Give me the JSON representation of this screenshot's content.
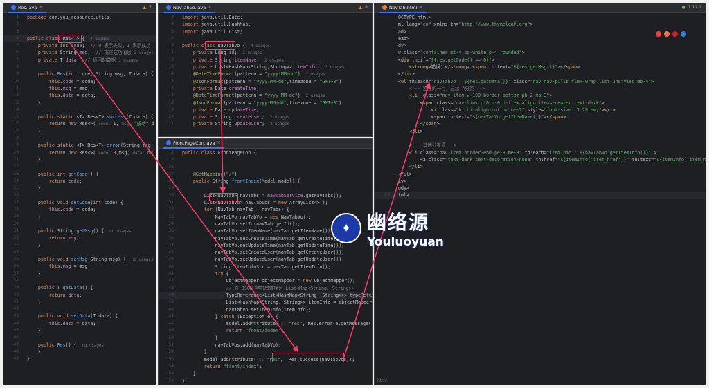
{
  "panes": {
    "res": {
      "tab": "Res.java",
      "status": "7",
      "lines": [
        {
          "n": "1",
          "html": "<span class='kw'>package</span> com.you_resource.utils;"
        },
        {
          "n": "2",
          "html": ""
        },
        {
          "n": "3",
          "html": ""
        },
        {
          "n": "4",
          "html": "<span class='kw'>public class</span> Res&lt;T&gt; {  <span class='hint'>7 usages</span>"
        },
        {
          "n": "5",
          "html": "    <span class='kw'>private int</span> <span class='fld'>code</span>;  <span class='cm'>// 0 表示失败，1 表示成功</span>"
        },
        {
          "n": "6",
          "html": "    <span class='kw'>private</span> String <span class='fld'>msg</span>;  <span class='cm'>// 描述成功消息</span> <span class='hint'>3 usages</span>"
        },
        {
          "n": "7",
          "html": "    <span class='kw'>private</span> T <span class='fld'>data</span>;  <span class='cm'>// 返回的数据</span> <span class='hint'>3 usages</span>"
        },
        {
          "n": "8",
          "html": ""
        },
        {
          "n": "9",
          "html": "    <span class='kw'>public</span> <span class='fn'>Res</span>(<span class='kw'>int</span> code, String msg, T data) {"
        },
        {
          "n": "10",
          "html": "        <span class='kw'>this</span>.<span class='fld'>code</span> = code;"
        },
        {
          "n": "11",
          "html": "        <span class='kw'>this</span>.<span class='fld'>msg</span> = msg;"
        },
        {
          "n": "12",
          "html": "        <span class='kw'>this</span>.<span class='fld'>data</span> = data;"
        },
        {
          "n": "13",
          "html": "    }"
        },
        {
          "n": "14",
          "html": ""
        },
        {
          "n": "15",
          "html": "    <span class='kw'>public static</span> &lt;T&gt; Res&lt;T&gt; <span class='fn'>success</span>(T data) {"
        },
        {
          "n": "16",
          "html": "        <span class='kw'>return new</span> Res&lt;&gt;( <span class='hint'>code:</span> 1, <span class='hint'>msg:</span> <span class='str'>\"成功\"</span>,d"
        },
        {
          "n": "17",
          "html": "    }"
        },
        {
          "n": "18",
          "html": ""
        },
        {
          "n": "19",
          "html": "    <span class='kw'>public static</span> &lt;T&gt; Res&lt;T&gt; <span class='fn'>error</span>(String msg) {"
        },
        {
          "n": "20",
          "html": "        <span class='kw'>return new</span> Res&lt;&gt;( <span class='hint'>code:</span> 0,msg, <span class='hint'>data:</span> <span class='kw'>null</span>"
        },
        {
          "n": "21",
          "html": "    }"
        },
        {
          "n": "22",
          "html": ""
        },
        {
          "n": "23",
          "html": "    <span class='kw'>public int</span> <span class='fn'>getCode</span>() {"
        },
        {
          "n": "24",
          "html": "        <span class='kw'>return</span> <span class='fld'>code</span>;"
        },
        {
          "n": "25",
          "html": "    }"
        },
        {
          "n": "26",
          "html": ""
        },
        {
          "n": "27",
          "html": "    <span class='kw'>public void</span> <span class='fn'>setCode</span>(<span class='kw'>int</span> code) {"
        },
        {
          "n": "28",
          "html": "        <span class='kw'>this</span>.<span class='fld'>code</span> = code;"
        },
        {
          "n": "29",
          "html": "    }"
        },
        {
          "n": "30",
          "html": ""
        },
        {
          "n": "31",
          "html": "    <span class='kw'>public</span> String <span class='fn'>getMsg</span>() {  <span class='hint'>no usages</span>"
        },
        {
          "n": "32",
          "html": "        <span class='kw'>return</span> <span class='fld'>msg</span>;"
        },
        {
          "n": "33",
          "html": "    }"
        },
        {
          "n": "34",
          "html": ""
        },
        {
          "n": "35",
          "html": "    <span class='kw'>public void</span> <span class='fn'>setMsg</span>(String msg) {  <span class='hint'>no usages</span>"
        },
        {
          "n": "36",
          "html": "        <span class='kw'>this</span>.<span class='fld'>msg</span> = msg;"
        },
        {
          "n": "37",
          "html": "    }"
        },
        {
          "n": "38",
          "html": ""
        },
        {
          "n": "39",
          "html": "    <span class='kw'>public</span> T <span class='fn'>getData</span>() {"
        },
        {
          "n": "40",
          "html": "        <span class='kw'>return</span> <span class='fld'>data</span>;"
        },
        {
          "n": "41",
          "html": "    }"
        },
        {
          "n": "42",
          "html": ""
        },
        {
          "n": "43",
          "html": "    <span class='kw'>public void</span> <span class='fn'>setData</span>(T data) {"
        },
        {
          "n": "44",
          "html": "        <span class='kw'>this</span>.<span class='fld'>data</span> = data;"
        },
        {
          "n": "45",
          "html": "    }"
        },
        {
          "n": "46",
          "html": ""
        },
        {
          "n": "47",
          "html": "    <span class='kw'>public</span> <span class='fn'>Res</span>() {  <span class='hint'>no usages</span>"
        },
        {
          "n": "48",
          "html": "    }"
        },
        {
          "n": "49",
          "html": "}"
        }
      ]
    },
    "vo": {
      "tab": "NavTabVo.java",
      "status": "8",
      "lines": [
        {
          "n": "3",
          "html": "<span class='kw'>import</span> java.util.Date;"
        },
        {
          "n": "4",
          "html": "<span class='kw'>import</span> java.util.HashMap;"
        },
        {
          "n": "5",
          "html": "<span class='kw'>import</span> java.util.List;"
        },
        {
          "n": "6",
          "html": ""
        },
        {
          "n": "10",
          "html": "<span class='kw'>public class</span> NavTabVo {  <span class='hint'>4 usages</span>"
        },
        {
          "n": "11",
          "html": "    <span class='kw'>private</span> Long <span class='fld'>id</span>;  <span class='hint'>2 usages</span>"
        },
        {
          "n": "12",
          "html": "    <span class='kw'>private</span> String <span class='fld'>itemName</span>;  <span class='hint'>2 usages</span>"
        },
        {
          "n": "13",
          "html": "    <span class='kw'>private</span> List&lt;HashMap&lt;String,String&gt;&gt; <span class='fld'>itemInfo</span>;  <span class='hint'>2 usages</span>"
        },
        {
          "n": "14",
          "html": "    <span class='ann'>@DateTimeFormat</span>(pattern = <span class='str'>\"yyyy-MM-dd\"</span>)  <span class='hint'>2 usages</span>"
        },
        {
          "n": "15",
          "html": "    <span class='ann'>@JsonFormat</span>(pattern = <span class='str'>\"yyyy-MM-dd\"</span>,timezone = <span class='str'>\"GMT+8\"</span>)"
        },
        {
          "n": "16",
          "html": "    <span class='kw'>private</span> Date <span class='fld'>createTime</span>;"
        },
        {
          "n": "17",
          "html": "    <span class='ann'>@DateTimeFormat</span>(pattern = <span class='str'>\"yyyy-MM-dd\"</span>)  <span class='hint'>2 usages</span>"
        },
        {
          "n": "18",
          "html": "    <span class='ann'>@JsonFormat</span>(pattern = <span class='str'>\"yyyy-MM-dd\"</span>,timezone = <span class='str'>\"GMT+8\"</span>)"
        },
        {
          "n": "19",
          "html": "    <span class='kw'>private</span> Date <span class='fld'>updateTime</span>;"
        },
        {
          "n": "20",
          "html": "    <span class='kw'>private</span> String <span class='fld'>createUser</span>;  <span class='hint'>2 usages</span>"
        },
        {
          "n": "21",
          "html": "    <span class='kw'>private</span> String <span class='fld'>updateUser</span>;  <span class='hint'>2 usages</span>"
        }
      ]
    },
    "con": {
      "tab": "FrontPageCon.java",
      "lines": [
        {
          "n": "18",
          "html": "<span class='kw'>public class</span> FrontPageCon {"
        },
        {
          "n": "19",
          "html": ""
        },
        {
          "n": "26",
          "html": ""
        },
        {
          "n": "27",
          "html": "    <span class='ann'>@GetMapping</span>(<span class='str'>\"/\"</span>)"
        },
        {
          "n": "28",
          "html": "    <span class='kw'>public</span> String <span class='fn'>frontIndex</span>(Model model) {"
        },
        {
          "n": "29",
          "html": ""
        },
        {
          "n": "30",
          "html": "        List&lt;NavTab&gt; navTabs = <span class='fld'>navTabService</span>.getNavTabs();"
        },
        {
          "n": "31",
          "html": "        List&lt;NavTabVo&gt; navTabVos = <span class='kw'>new</span> ArrayList&lt;&gt;();"
        },
        {
          "n": "32",
          "html": "        <span class='kw'>for</span> (NavTab navTab : navTabs) {"
        },
        {
          "n": "33",
          "html": "            NavTabVo navTabVo = <span class='kw'>new</span> NavTabVo();"
        },
        {
          "n": "34",
          "html": "            navTabVo.setId(navTab.getId());"
        },
        {
          "n": "35",
          "html": "            navTabVo.setItemName(navTab.getItemName());"
        },
        {
          "n": "36",
          "html": "            navTabVo.setCreateTime(navTab.getCreateTime());"
        },
        {
          "n": "37",
          "html": "            navTabVo.setUpdateTime(navTab.getUpdateTime());"
        },
        {
          "n": "38",
          "html": "            navTabVo.setCreateUser(navTab.getCreateUser());"
        },
        {
          "n": "39",
          "html": "            navTabVo.setUpdateUser(navTab.getUpdateUser());"
        },
        {
          "n": "40",
          "html": "            String itemInfoStr = navTab.getItemInfo();"
        },
        {
          "n": "41",
          "html": "            <span class='kw'>try</span> {"
        },
        {
          "n": "42",
          "html": "                ObjectMapper objectMapper = <span class='kw'>new</span> ObjectMapper();"
        },
        {
          "n": "43",
          "html": "                <span class='cm'>// 将 JSON 字符串转换为 List&lt;Map&lt;String, String&gt;&gt;</span>"
        },
        {
          "n": "44",
          "html": "                TypeReference&lt;List&lt;HashMap&lt;String, String&gt;&gt;&gt; typeReference"
        },
        {
          "n": "45",
          "html": "                List&lt;HashMap&lt;String, String&gt;&gt; itemInfo = objectMapper.read"
        },
        {
          "n": "46",
          "html": "                navTabVo.setItemInfo(itemInfo);"
        },
        {
          "n": "47",
          "html": "            } <span class='kw'>catch</span> (Exception e) {"
        },
        {
          "n": "48",
          "html": "                model.addAttribute( <span class='hint'>s:</span> <span class='str'>\"res\"</span>, Res.error(e.getMessage()));"
        },
        {
          "n": "49",
          "html": "                <span class='kw'>return</span> <span class='str'>\"front/index\"</span>;"
        },
        {
          "n": "50",
          "html": "            }"
        },
        {
          "n": "51",
          "html": "            navTabVos.add(navTabVo);"
        },
        {
          "n": "52",
          "html": "        }"
        },
        {
          "n": "53",
          "html": "        model.addAttribute( <span class='hint'>s:</span> <span class='str'>\"res\"</span>,  Res.success(navTabVos));"
        },
        {
          "n": "54",
          "html": "        <span class='kw'>return</span> <span class='str'>\"front/index\"</span>;"
        },
        {
          "n": "55",
          "html": "    }"
        },
        {
          "n": "56",
          "html": "}"
        }
      ]
    },
    "html": {
      "tab": "NavTab.html",
      "status": "1  12  1",
      "footer": "html",
      "lines": [
        {
          "n": "",
          "html": "OCTYPE html&gt;"
        },
        {
          "n": "",
          "html": "ml lang=<span class='str'>\"en\"</span> xmlns:th=<span class='str'>\"http://www.thymeleaf.org\"</span>&gt;"
        },
        {
          "n": "",
          "html": "ad&gt;"
        },
        {
          "n": "",
          "html": "ead&gt;"
        },
        {
          "n": "",
          "html": "dy&gt;"
        },
        {
          "n": "",
          "html": "v <span class='attr'>class</span>=<span class='str'>\"container mt-4 bg-white p-4 rounded\"</span>&gt;"
        },
        {
          "n": "",
          "html": "&lt;<span class='tag'>div</span> th:if=<span class='str'>\"${res.getCode() == 0}\"</span>&gt;"
        },
        {
          "n": "",
          "html": "    &lt;<span class='tag'>strong</span>&gt;错误：&lt;/<span class='tag'>strong</span>&gt; &lt;<span class='tag'>span</span> th:text=<span class='str'>\"${res.getMsg()}\"</span>&gt;&lt;/<span class='tag'>span</span>&gt;"
        },
        {
          "n": "",
          "html": "&lt;/<span class='tag'>div</span>&gt;"
        },
        {
          "n": "",
          "html": "&lt;<span class='tag'>ul</span> th:each=<span class='str'>\"navTabVo : ${res.getData()}\"</span> class=<span class='str'>\"nav nav-pills flex-wrap list-unstyled mb-4\"</span>&gt;"
        },
        {
          "n": "",
          "html": "    <span class='cm'>&lt;!-- 独立的一行，显示 A分类 --&gt;</span>"
        },
        {
          "n": "",
          "html": "    &lt;<span class='tag'>li</span>  class=<span class='str'>\"nav-item w-100 border-bottom pb-2 mb-3\"</span>&gt;"
        },
        {
          "n": "",
          "html": "        &lt;<span class='tag'>span</span> class=<span class='str'>\"nav-link p-0 m-0 d-flex align-items-center text-dark\"</span>&gt;"
        },
        {
          "n": "",
          "html": "            &lt;<span class='tag'>i</span> class=<span class='str'>\"bi bi-align-bottom me-2\"</span> style=<span class='str'>\"font-size: 1.25rem;\"</span>&gt;&lt;/<span class='tag'>i</span>&gt;"
        },
        {
          "n": "",
          "html": "            &lt;<span class='tag'>span</span> th:text=<span class='str'>\"${navTabVo.getItemName()}\"</span>&gt;&lt;/<span class='tag'>span</span>&gt;"
        },
        {
          "n": "",
          "html": "        &lt;/<span class='tag'>span</span>&gt;"
        },
        {
          "n": "",
          "html": "    &lt;/<span class='tag'>li</span>&gt;"
        },
        {
          "n": "",
          "html": ""
        },
        {
          "n": "",
          "html": "    <span class='cm'>&lt;!-- 其他分类项 --&gt;</span>"
        },
        {
          "n": "",
          "html": "    &lt;<span class='tag'>li</span> class=<span class='str'>\"nav-item border-end pe-3 me-3\"</span> th:each=<span class='str'>\"itemInfo : ${navTabVo.getItemInfo()}\"</span> &gt;"
        },
        {
          "n": "",
          "html": "        &lt;<span class='tag'>a</span> class=<span class='str'>\"text-dark text-decoration-none\"</span> th:href=<span class='str'>\"${itemInfo['item_href']}\"</span> th:text=<span class='str'>\"${itemInfo['item_name']}</span>"
        },
        {
          "n": "",
          "html": "    &lt;/<span class='tag'>li</span>&gt;"
        },
        {
          "n": "",
          "html": "&lt;/<span class='tag'>ul</span>&gt;"
        },
        {
          "n": "",
          "html": "iv&gt;"
        },
        {
          "n": "",
          "html": "ody&gt;"
        },
        {
          "n": "26",
          "html": "tml&gt;"
        }
      ]
    }
  },
  "watermark": {
    "cn": "幽络源",
    "en": "Youluoyuan"
  }
}
